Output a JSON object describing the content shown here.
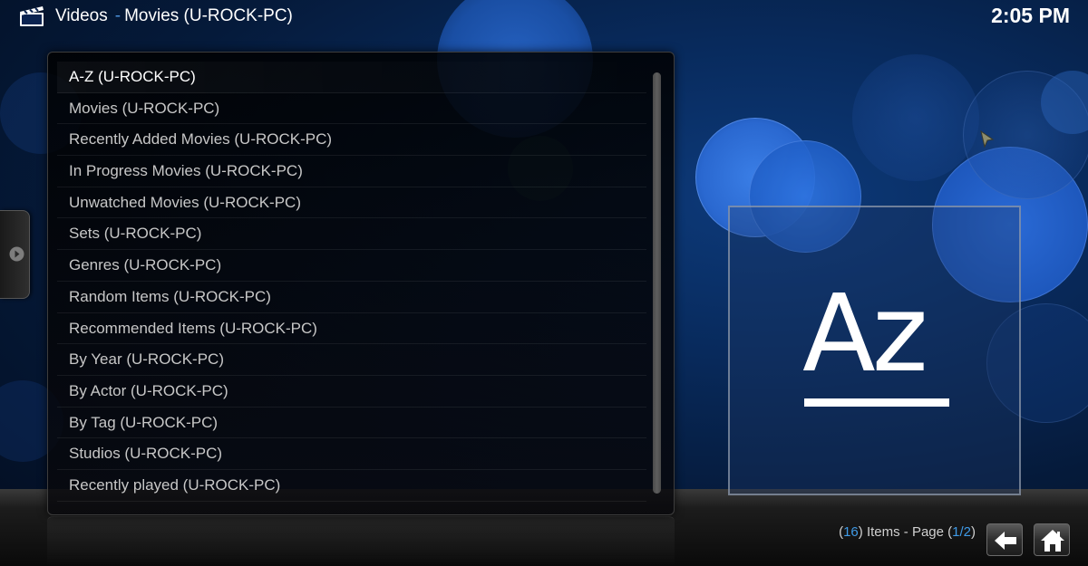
{
  "header": {
    "section": "Videos",
    "separator": "-",
    "subtitle": "Movies (U-ROCK-PC)",
    "clock": "2:05 PM",
    "icon": "clapperboard-icon"
  },
  "list": {
    "selected_index": 0,
    "items": [
      "A-Z (U-ROCK-PC)",
      "Movies (U-ROCK-PC)",
      "Recently Added Movies (U-ROCK-PC)",
      "In Progress Movies (U-ROCK-PC)",
      "Unwatched Movies (U-ROCK-PC)",
      "Sets (U-ROCK-PC)",
      "Genres (U-ROCK-PC)",
      "Random Items (U-ROCK-PC)",
      "Recommended Items (U-ROCK-PC)",
      "By Year (U-ROCK-PC)",
      "By Actor (U-ROCK-PC)",
      "By Tag (U-ROCK-PC)",
      "Studios (U-ROCK-PC)",
      "Recently played (U-ROCK-PC)"
    ]
  },
  "thumbnail": {
    "glyph": "Az",
    "icon": "a-z-sort-icon"
  },
  "status": {
    "open_paren": "(",
    "count": "16",
    "items_page_text": ") Items - Page (",
    "page": "1/2",
    "close_paren": ")"
  },
  "buttons": {
    "back_icon": "back-arrow-icon",
    "home_icon": "home-icon"
  },
  "colors": {
    "accent": "#3f9ae6",
    "background": "#082a5c"
  }
}
